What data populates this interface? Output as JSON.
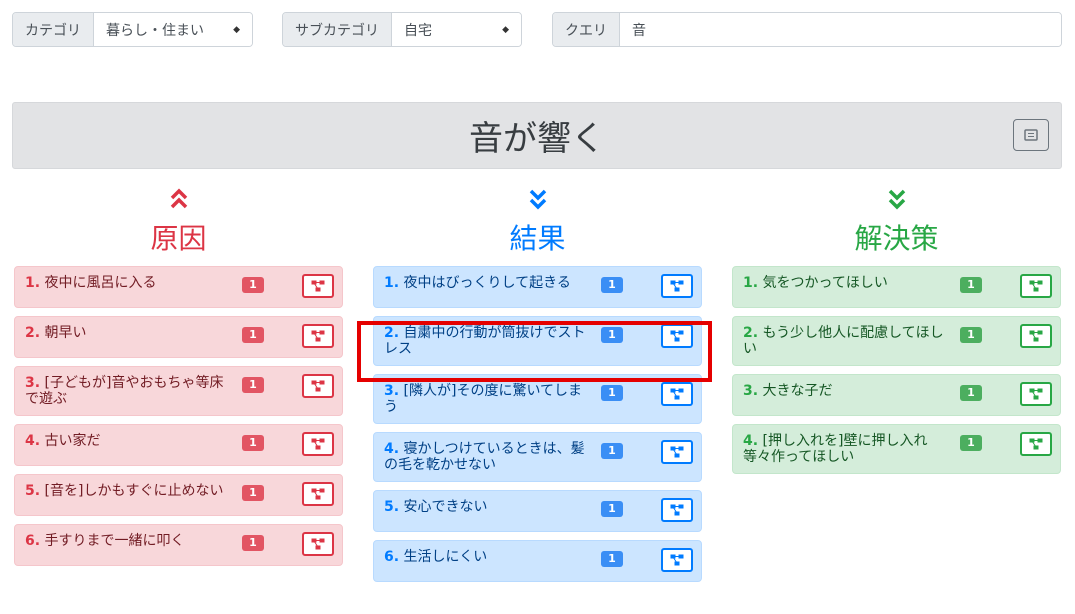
{
  "filters": {
    "category": {
      "label": "カテゴリ",
      "value": "暮らし・住まい"
    },
    "subcategory": {
      "label": "サブカテゴリ",
      "value": "自宅"
    },
    "query": {
      "label": "クエリ",
      "value": "音"
    }
  },
  "header": {
    "title": "音が響く"
  },
  "columns": [
    {
      "title": "原因",
      "chevron": "double-up",
      "items": [
        {
          "num": "1.",
          "text": "夜中に風呂に入る",
          "count": "1"
        },
        {
          "num": "2.",
          "text": "朝早い",
          "count": "1"
        },
        {
          "num": "3.",
          "text": "[子どもが]音やおもちゃ等床で遊ぶ",
          "count": "1"
        },
        {
          "num": "4.",
          "text": "古い家だ",
          "count": "1"
        },
        {
          "num": "5.",
          "text": "[音を]しかもすぐに止めない",
          "count": "1"
        },
        {
          "num": "6.",
          "text": "手すりまで一緒に叩く",
          "count": "1"
        }
      ]
    },
    {
      "title": "結果",
      "chevron": "double-down",
      "items": [
        {
          "num": "1.",
          "text": "夜中はびっくりして起きる",
          "count": "1"
        },
        {
          "num": "2.",
          "text": "自粛中の行動が筒抜けでストレス",
          "count": "1"
        },
        {
          "num": "3.",
          "text": "[隣人が]その度に驚いてしまう",
          "count": "1"
        },
        {
          "num": "4.",
          "text": "寝かしつけているときは、髪の毛を乾かせない",
          "count": "1"
        },
        {
          "num": "5.",
          "text": "安心できない",
          "count": "1"
        },
        {
          "num": "6.",
          "text": "生活しにくい",
          "count": "1"
        }
      ]
    },
    {
      "title": "解決策",
      "chevron": "double-down",
      "items": [
        {
          "num": "1.",
          "text": "気をつかってほしい",
          "count": "1"
        },
        {
          "num": "2.",
          "text": "もう少し他人に配慮してほしい",
          "count": "1"
        },
        {
          "num": "3.",
          "text": "大きな子だ",
          "count": "1"
        },
        {
          "num": "4.",
          "text": "[押し入れを]壁に押し入れ等々作ってほしい",
          "count": "1"
        }
      ]
    }
  ],
  "colors": {
    "cause": "#dc3545",
    "result": "#007bff",
    "solution": "#28a745",
    "highlight": "#e50000"
  }
}
